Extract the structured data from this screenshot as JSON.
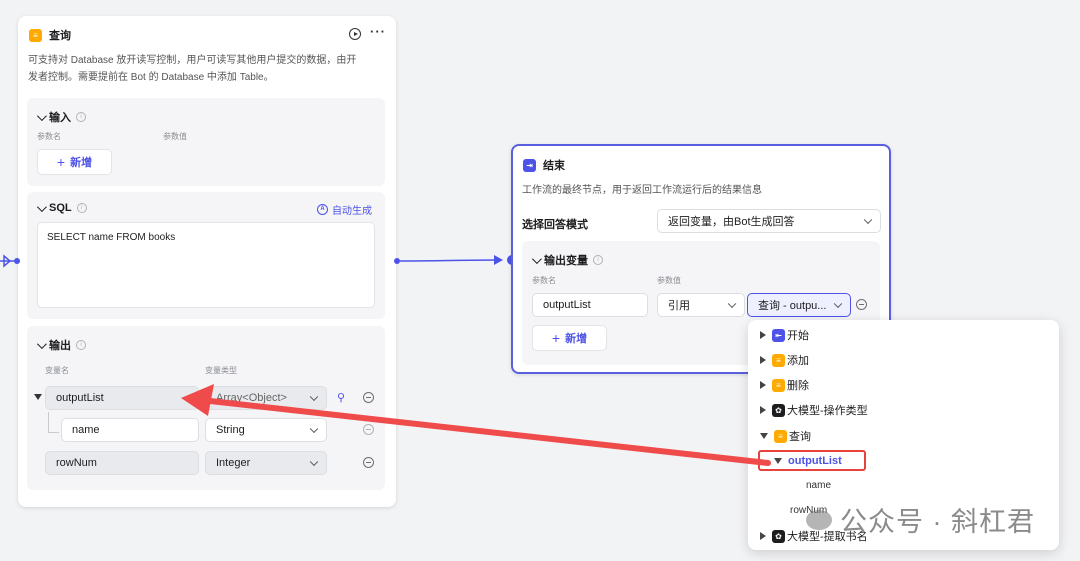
{
  "query_node": {
    "title": "查询",
    "description_line1": "可支持对 Database 放开读写控制，用户可读写其他用户提交的数据，由开",
    "description_line2": "发者控制。需要提前在 Bot 的 Database 中添加 Table。",
    "input": {
      "title": "输入",
      "col_name": "参数名",
      "col_value": "参数值",
      "add_label": "新增"
    },
    "sql": {
      "title": "SQL",
      "auto_generate": "自动生成",
      "query_text": "SELECT name FROM books"
    },
    "output": {
      "title": "输出",
      "col_name": "变量名",
      "col_type": "变量类型",
      "rows": [
        {
          "name": "outputList",
          "type": "Array<Object>"
        },
        {
          "name": "name",
          "type": "String"
        },
        {
          "name": "rowNum",
          "type": "Integer"
        }
      ]
    }
  },
  "end_node": {
    "title": "结束",
    "description": "工作流的最终节点，用于返回工作流运行后的结果信息",
    "mode_label": "选择回答模式",
    "mode_value": "返回变量，由Bot生成回答",
    "output_vars": {
      "title": "输出变量",
      "col_name": "参数名",
      "col_value": "参数值",
      "param_name": "outputList",
      "ref_type": "引用",
      "ref_value": "查询 - outpu...",
      "add_label": "新增"
    }
  },
  "dropdown": {
    "items": [
      {
        "label": "开始",
        "icon": "start-node-icon"
      },
      {
        "label": "添加",
        "icon": "database-node-icon"
      },
      {
        "label": "删除",
        "icon": "database-node-icon"
      },
      {
        "label": "大模型-操作类型",
        "icon": "llm-node-icon"
      },
      {
        "label": "查询",
        "icon": "database-node-icon"
      }
    ],
    "selected": "outputList",
    "children": [
      "name",
      "rowNum"
    ],
    "last_item": "大模型-提取书名"
  },
  "watermark": "公众号 · 斜杠君",
  "colors": {
    "accent": "#4d53e8",
    "database_orange": "#ffaa00",
    "highlight_red": "#e8433a",
    "arrow_red": "#ef4b4b"
  }
}
